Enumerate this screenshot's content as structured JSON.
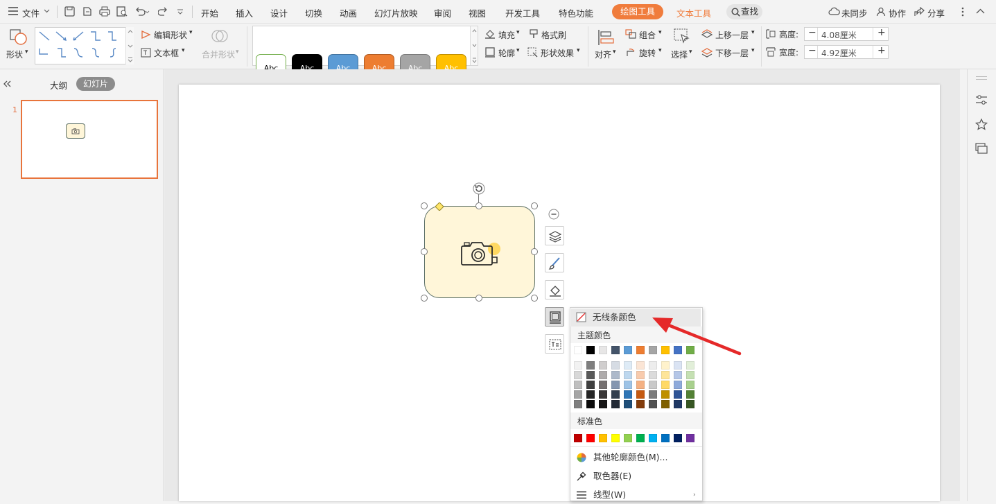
{
  "menubar": {
    "file_label": "文件",
    "tabs": [
      "开始",
      "插入",
      "设计",
      "切换",
      "动画",
      "幻灯片放映",
      "审阅",
      "视图",
      "开发工具",
      "特色功能"
    ],
    "active_tab": "绘图工具",
    "text_tool_tab": "文本工具",
    "search_label": "查找",
    "sync_label": "未同步",
    "collab_label": "协作",
    "share_label": "分享"
  },
  "ribbon": {
    "shapes_label": "形状",
    "edit_shape_label": "编辑形状",
    "textbox_label": "文本框",
    "merge_shape_label": "合并形状",
    "style_buttons": [
      {
        "label": "Abc",
        "bg": "#ffffff",
        "fg": "#000000",
        "border": "#70ad47"
      },
      {
        "label": "Abc",
        "bg": "#000000",
        "fg": "#ffffff",
        "border": "#000000"
      },
      {
        "label": "Abc",
        "bg": "#5b9bd5",
        "fg": "#ffffff",
        "border": "#41719c"
      },
      {
        "label": "Abc",
        "bg": "#ed7d31",
        "fg": "#ffffff",
        "border": "#ae5a21"
      },
      {
        "label": "Abc",
        "bg": "#a5a5a5",
        "fg": "#ffffff",
        "border": "#787878"
      },
      {
        "label": "Abc",
        "bg": "#ffc000",
        "fg": "#ffffff",
        "border": "#bc8c00"
      }
    ],
    "fill_label": "填充",
    "format_painter_label": "格式刷",
    "outline_label": "轮廓",
    "shape_effect_label": "形状效果",
    "align_label": "对齐",
    "group_label": "组合",
    "rotate_label": "旋转",
    "select_label": "选择",
    "bring_forward_label": "上移一层",
    "send_backward_label": "下移一层",
    "height_label": "高度:",
    "height_value": "4.08厘米",
    "width_label": "宽度:",
    "width_value": "4.92厘米"
  },
  "leftpanel": {
    "outline_tab": "大纲",
    "slides_tab": "幻灯片",
    "slide_number": "1"
  },
  "outline_menu": {
    "no_line_label": "无线条颜色",
    "theme_colors_label": "主题颜色",
    "theme_top": [
      "#ffffff",
      "#000000",
      "#e7e6e6",
      "#44546a",
      "#5b9bd5",
      "#ed7d31",
      "#a5a5a5",
      "#ffc000",
      "#4472c4",
      "#70ad47"
    ],
    "theme_shades": [
      [
        "#f2f2f2",
        "#7f7f7f",
        "#d0cece",
        "#d6dce4",
        "#deebf6",
        "#fbe5d5",
        "#ededed",
        "#fff2cc",
        "#dae3f3",
        "#e2efd9"
      ],
      [
        "#d8d8d8",
        "#595959",
        "#aeabab",
        "#adb9ca",
        "#bdd7ee",
        "#f8cbad",
        "#dbdbdb",
        "#fee599",
        "#b4c6e7",
        "#c5e0b3"
      ],
      [
        "#bfbfbf",
        "#3f3f3f",
        "#757070",
        "#8496b0",
        "#9dc3e6",
        "#f4b183",
        "#c9c9c9",
        "#ffd965",
        "#8eaadb",
        "#a8d08d"
      ],
      [
        "#a5a5a5",
        "#262626",
        "#3a3838",
        "#323f4f",
        "#2e75b5",
        "#c55a11",
        "#7b7b7b",
        "#bf9000",
        "#2f5496",
        "#538135"
      ],
      [
        "#7f7f7f",
        "#0c0c0c",
        "#171616",
        "#222a35",
        "#1e4e79",
        "#833c0b",
        "#525252",
        "#7f6000",
        "#1f3864",
        "#375623"
      ]
    ],
    "standard_colors_label": "标准色",
    "standard_colors": [
      "#c00000",
      "#ff0000",
      "#ffc000",
      "#ffff00",
      "#92d050",
      "#00b050",
      "#00b0f0",
      "#0070c0",
      "#002060",
      "#7030a0"
    ],
    "more_colors_label": "其他轮廓颜色(M)...",
    "eyedropper_label": "取色器(E)",
    "line_style_label": "线型(W)"
  },
  "colors": {
    "accent": "#f07c3c",
    "shape_fill": "#fff6d9",
    "shape_border": "#5b6f66",
    "arrow": "#e52929"
  }
}
